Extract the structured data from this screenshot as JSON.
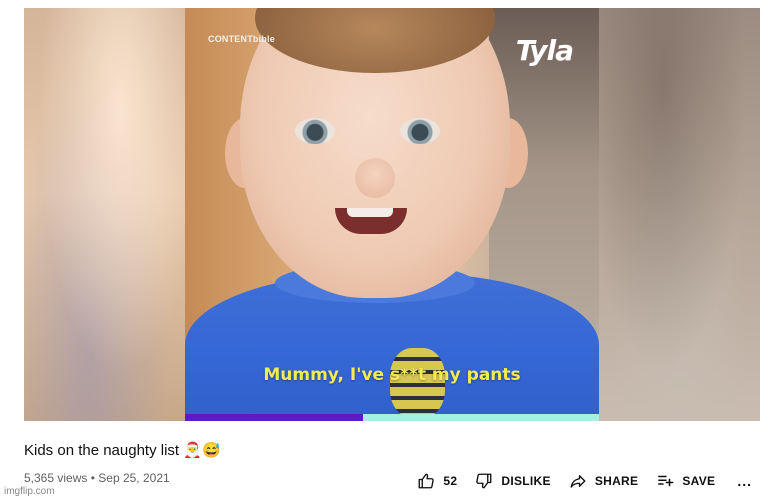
{
  "video": {
    "watermark_left": "CONTENTbible",
    "watermark_right": "Tyla",
    "caption": "Mummy, I've s**t my pants",
    "progress": 0.43
  },
  "title": "Kids on the naughty list 🎅😅",
  "meta": {
    "views": "5,365 views",
    "date": "Sep 25, 2021"
  },
  "actions": {
    "like_count": "52",
    "dislike_label": "DISLIKE",
    "share_label": "SHARE",
    "save_label": "SAVE",
    "more_label": "..."
  },
  "watermark": "imgflip.com",
  "colors": {
    "progress": "#5b1cc8",
    "progress_track": "#a7efe3",
    "caption": "#f3ea54"
  }
}
